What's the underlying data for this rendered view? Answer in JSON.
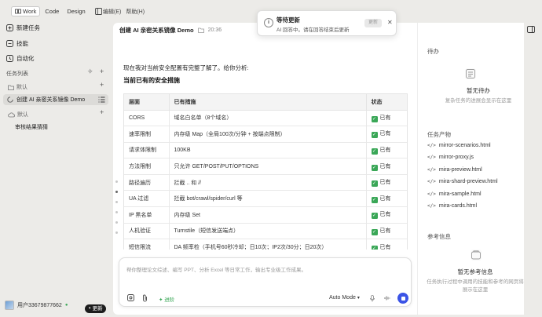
{
  "modes": [
    {
      "label": "Work",
      "active": true
    },
    {
      "label": "Code",
      "active": false
    },
    {
      "label": "Design",
      "active": false
    }
  ],
  "menu": [
    "编辑(E)",
    "帮助(H)"
  ],
  "sidebar": {
    "nav": [
      "新建任务",
      "技能",
      "自动化"
    ],
    "task_list_label": "任务列表",
    "folder1": "默认",
    "active_task": "创建 AI 亲密关系镜像 Demo",
    "folder2": "默认",
    "sub_task": "审核结果猜猜"
  },
  "user": {
    "name": "用户33679877662",
    "upgrade": "更新"
  },
  "header": {
    "title": "创建 AI 亲密关系镜像 Demo",
    "time": "20:36"
  },
  "content": {
    "intro": "现在我对当前安全配置有完整了解了。给你分析:",
    "heading": "当前已有的安全措施",
    "columns": [
      "层面",
      "已有措施",
      "状态"
    ],
    "rows": [
      {
        "layer": "CORS",
        "measure": "域名白名单（8个域名）",
        "status": "已有"
      },
      {
        "layer": "速率限制",
        "measure": "内存级 Map（全局100次/分钟 + 按端点限制）",
        "status": "已有"
      },
      {
        "layer": "请求体限制",
        "measure": "100KB",
        "status": "已有"
      },
      {
        "layer": "方法限制",
        "measure": "只允许 GET/POST/PUT/OPTIONS",
        "status": "已有"
      },
      {
        "layer": "路径遍历",
        "measure": "拦截 .. 和 //",
        "status": "已有"
      },
      {
        "layer": "UA 过滤",
        "measure": "拦截 bot/crawl/spider/curl 等",
        "status": "已有"
      },
      {
        "layer": "IP 黑名单",
        "measure": "内存级 Set",
        "status": "已有"
      },
      {
        "layer": "人机验证",
        "measure": "Turnstile（短信发送端点）",
        "status": "已有"
      },
      {
        "layer": "短信限流",
        "measure": "DA 频率检（手机号60秒冷却；日10次；IP2次/30分；日20次）",
        "status": "已有"
      }
    ]
  },
  "composer": {
    "placeholder": "帮你整理论文综述、编写 PPT、分析 Excel 等日常工作，输出专业级工作成果。",
    "skills": "进阶",
    "mode": "Auto Mode"
  },
  "right": {
    "todo_label": "待办",
    "todo_empty": "暂无待办",
    "todo_hint": "复杂任务的进展会显示在这里",
    "files_label": "任务产物",
    "files": [
      "mirror-scenarios.html",
      "mirror-proxy.js",
      "mira-preview.html",
      "mira-shard-preview.html",
      "mira-sample.html",
      "mira-cards.html"
    ],
    "refs_label": "参考信息",
    "refs_empty": "暂无参考信息",
    "refs_hint": "任务执行过程中调用的技能和参考的网页将展示在这里"
  },
  "toast": {
    "title": "等待更新",
    "subtitle": "AI 回答中。请在回答结束后更新",
    "button": "更新"
  }
}
